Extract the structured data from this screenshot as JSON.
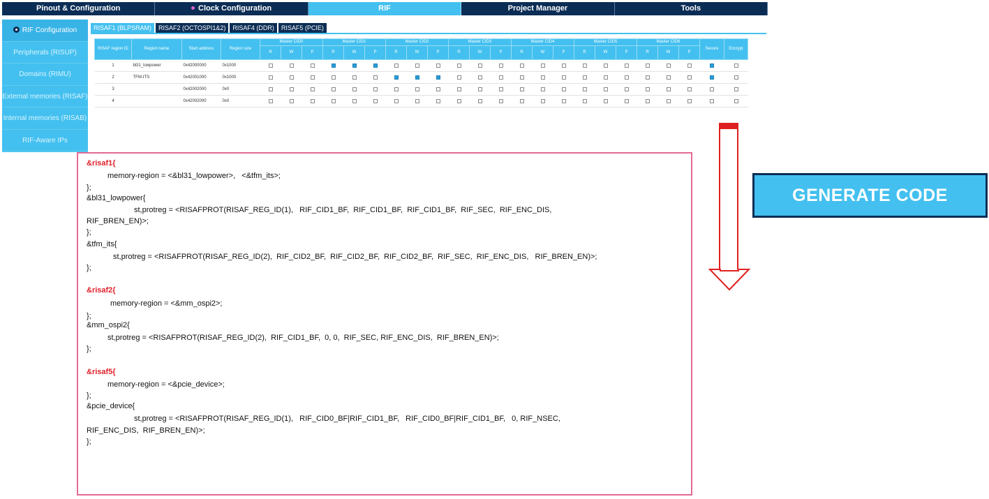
{
  "topnav": {
    "tabs": [
      "Pinout & Configuration",
      "Clock Configuration",
      "RIF",
      "Project Manager",
      "Tools"
    ]
  },
  "sidebar": {
    "items": [
      "RIF Configuration",
      "Peripherals (RISUP)",
      "Domains (RIMU)",
      "External memories (RISAF)",
      "Internal memories (RISAB)",
      "RIF-Aware IPs"
    ]
  },
  "subtabs": [
    "RISAF1 (BLPSRAM)",
    "RISAF2 (OCTOSPI1&2)",
    "RISAF4 (DDR)",
    "RISAF5 (PCIE)"
  ],
  "table": {
    "col_region_id": "RISAF region ID",
    "col_region_name": "Region name",
    "col_start_address": "Start address",
    "col_region_size": "Region size",
    "masters": [
      "Master CID0",
      "Master CID1",
      "Master CID2",
      "Master CID3",
      "Master CID4",
      "Master CID5",
      "Master CID6"
    ],
    "rwp": [
      "R",
      "W",
      "P"
    ],
    "col_secure": "Secure",
    "col_encrypt": "Encrypt",
    "rows": [
      {
        "id": "1",
        "name": "bl31_lowpower",
        "start": "0x42000000",
        "size": "0x1000"
      },
      {
        "id": "2",
        "name": "TFM-ITS",
        "start": "0x42001000",
        "size": "0x1000"
      },
      {
        "id": "3",
        "name": "",
        "start": "0x42002000",
        "size": "0x0"
      },
      {
        "id": "4",
        "name": "",
        "start": "0x42002000",
        "size": "0x0"
      }
    ]
  },
  "code": {
    "l01": "&risaf1{",
    "l02": "memory-region = <&bl31_lowpower>,   <&tfm_its>;",
    "l03": "};",
    "l04": "&bl31_lowpower{",
    "l05": "st,protreg = <RISAFPROT(RISAF_REG_ID(1),   RIF_CID1_BF,  RIF_CID1_BF,  RIF_CID1_BF,  RIF_SEC,  RIF_ENC_DIS,",
    "l06": "RIF_BREN_EN)>;",
    "l07": "};",
    "l08": "&tfm_its{",
    "l09": "st,protreg = <RISAFPROT(RISAF_REG_ID(2),  RIF_CID2_BF,  RIF_CID2_BF,  RIF_CID2_BF,  RIF_SEC,  RIF_ENC_DIS,   RIF_BREN_EN)>;",
    "l10": "};",
    "l11": "&risaf2{",
    "l12": "memory-region = <&mm_ospi2>;",
    "l13": "};",
    "l14": "&mm_ospi2{",
    "l15": "st,protreg = <RISAFPROT(RISAF_REG_ID(2),  RIF_CID1_BF,  0, 0,  RIF_SEC, RIF_ENC_DIS,  RIF_BREN_EN)>;",
    "l16": "};",
    "l17": "&risaf5{",
    "l18": "memory-region = <&pcie_device>;",
    "l19": "};",
    "l20": "&pcie_device{",
    "l21": "st,protreg = <RISAFPROT(RISAF_REG_ID(1),   RIF_CID0_BF|RIF_CID1_BF,   RIF_CID0_BF|RIF_CID1_BF,   0, RIF_NSEC,",
    "l22": "RIF_ENC_DIS,  RIF_BREN_EN)>;",
    "l23": "};"
  },
  "generate_button": {
    "label": "GENERATE CODE"
  },
  "colors": {
    "navy": "#0b2d55",
    "cyan": "#43c0ef",
    "pink_border": "#e56a93",
    "red": "#e02020"
  }
}
